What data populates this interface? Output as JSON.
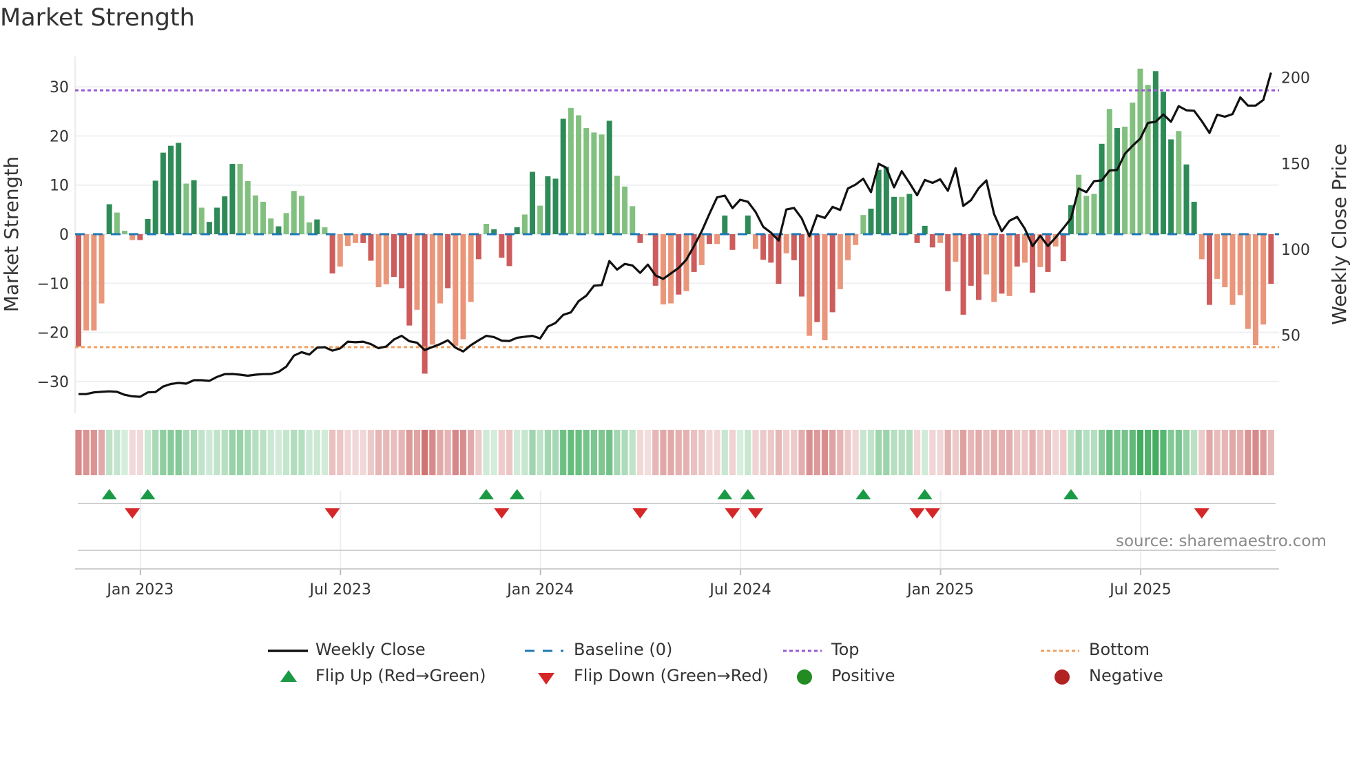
{
  "title": "Market Strength",
  "source": "source: sharemaestro.com",
  "chart_data": {
    "type": "bar+line",
    "title": "Market Strength",
    "ylabel_left": "Market Strength",
    "ylabel_right": "Weekly Close Price",
    "ylim_left": [
      -36,
      36
    ],
    "yticks_left": [
      "30",
      "20",
      "10",
      "0",
      "−10",
      "−20",
      "−30"
    ],
    "ytick_values_left": [
      30,
      20,
      10,
      0,
      -10,
      -20,
      -30
    ],
    "yticks_right": [
      "200",
      "150",
      "100",
      "50"
    ],
    "ytick_values_right": [
      200,
      150,
      100,
      50
    ],
    "xticks": [
      "Jan 2023",
      "Jul 2023",
      "Jan 2024",
      "Jul 2024",
      "Jan 2025",
      "Jul 2025"
    ],
    "xtick_week_index": [
      8,
      34,
      60,
      86,
      112,
      138
    ],
    "top_level": 29.3,
    "bottom_level": -23.0,
    "grid": true,
    "strength": [
      -22.9,
      -19.6,
      -19.6,
      -14.1,
      6.1,
      4.4,
      0.7,
      -1.2,
      -1.2,
      3.1,
      10.9,
      16.6,
      18.0,
      18.6,
      10.3,
      11.0,
      5.4,
      2.5,
      5.4,
      7.7,
      14.3,
      14.3,
      10.8,
      7.9,
      6.6,
      3.2,
      1.6,
      4.3,
      8.8,
      7.8,
      2.4,
      3.0,
      1.4,
      -8.0,
      -6.6,
      -2.4,
      -1.8,
      -1.8,
      -5.4,
      -10.8,
      -10.2,
      -8.7,
      -11.0,
      -18.6,
      -15.4,
      -28.4,
      -22.5,
      -14.1,
      -11.0,
      -22.7,
      -21.4,
      -13.8,
      -5.1,
      2.1,
      1.0,
      -4.8,
      -6.5,
      1.4,
      4.0,
      12.7,
      5.8,
      11.8,
      11.3,
      23.5,
      25.7,
      24.2,
      21.6,
      20.7,
      20.3,
      23.1,
      11.9,
      9.7,
      5.7,
      -1.8,
      -0.2,
      -10.5,
      -14.3,
      -14.1,
      -12.3,
      -11.6,
      -7.7,
      -6.3,
      -2.0,
      -2.0,
      3.8,
      -3.2,
      0.1,
      3.8,
      -3.0,
      -5.2,
      -5.8,
      -10.1,
      -3.9,
      -5.3,
      -12.7,
      -20.7,
      -17.9,
      -21.6,
      -15.9,
      -11.2,
      -5.3,
      -2.2,
      3.9,
      5.2,
      13.1,
      13.7,
      7.6,
      7.6,
      8.2,
      -1.8,
      1.7,
      -2.7,
      -1.8,
      -11.6,
      -5.6,
      -16.4,
      -10.5,
      -13.4,
      -8.2,
      -13.8,
      -12.1,
      -12.6,
      -6.6,
      -5.8,
      -11.9,
      -6.7,
      -7.7,
      -2.5,
      -5.5,
      5.9,
      12.1,
      7.8,
      8.2,
      18.4,
      25.5,
      21.6,
      21.9,
      26.8,
      33.7,
      30.4,
      33.2,
      29.0,
      19.3,
      21.0,
      14.2,
      6.6,
      -5.1,
      -14.4,
      -9.1,
      -10.8,
      -14.4,
      -12.4,
      -19.3,
      -22.6,
      -18.4,
      -10.1
    ],
    "shade": "dllldlllddddddldlddddllllldlllldldlllddlldddldlldllldlddddldldddllllldllldldlldldldlddldldddlddldldllllddddlddddldldddlldldldldlddllldldlllldddlddldllllllldldddlddldll",
    "weekly_close": [
      15.7,
      15.7,
      16.7,
      17.0,
      17.3,
      17.0,
      15.3,
      14.4,
      14.1,
      16.7,
      16.9,
      20.1,
      21.6,
      22.2,
      21.8,
      23.8,
      23.8,
      23.4,
      25.7,
      27.3,
      27.4,
      27.0,
      26.4,
      27.0,
      27.3,
      27.4,
      28.6,
      31.7,
      38.1,
      40.1,
      38.7,
      42.7,
      43.0,
      41.0,
      42.3,
      46.2,
      45.9,
      46.2,
      44.8,
      42.4,
      43.4,
      47.5,
      49.6,
      46.5,
      45.6,
      41.3,
      43.1,
      44.8,
      47.0,
      42.7,
      40.5,
      44.2,
      47.0,
      49.6,
      48.9,
      46.8,
      46.6,
      48.5,
      49.1,
      49.6,
      48.1,
      55.0,
      57.1,
      61.8,
      63.3,
      69.8,
      73.0,
      78.8,
      79.2,
      93.2,
      88.2,
      91.5,
      90.6,
      86.3,
      91.1,
      84.8,
      82.8,
      86.0,
      89.2,
      93.9,
      101.9,
      110.5,
      120.6,
      130.3,
      131.3,
      124.0,
      128.9,
      127.7,
      121.8,
      113.1,
      109.7,
      105.1,
      123.2,
      124.1,
      118.0,
      107.6,
      119.8,
      118.3,
      124.7,
      122.9,
      135.4,
      137.7,
      141.1,
      133.3,
      149.8,
      147.5,
      136.1,
      145.5,
      138.7,
      131.5,
      140.4,
      138.7,
      140.8,
      134.1,
      147.3,
      125.3,
      128.6,
      135.6,
      140.1,
      120.6,
      110.5,
      116.6,
      118.9,
      112.0,
      101.9,
      107.9,
      101.9,
      106.9,
      112.3,
      118.0,
      135.4,
      133.3,
      139.7,
      140.1,
      145.9,
      146.3,
      155.6,
      160.3,
      164.5,
      173.6,
      174.3,
      178.6,
      174.3,
      183.4,
      181.0,
      180.7,
      174.7,
      167.8,
      178.4,
      177.2,
      178.8,
      188.5,
      183.7,
      183.7,
      187.0,
      202.9
    ],
    "flip_up_weeks": [
      4,
      9,
      53,
      57,
      84,
      87,
      102,
      110,
      129
    ],
    "flip_down_weeks": [
      7,
      33,
      55,
      73,
      85,
      88,
      109,
      111,
      146
    ],
    "legend": {
      "weekly_close": "Weekly Close",
      "baseline": "Baseline (0)",
      "top": "Top",
      "bottom": "Bottom",
      "flip_up": "Flip Up (Red→Green)",
      "flip_down": "Flip Down (Green→Red)",
      "positive": "Positive",
      "negative": "Negative"
    },
    "colors": {
      "pos_dark": "#2e8b57",
      "pos_light": "#82c07f",
      "neg_dark": "#cd5c5c",
      "neg_light": "#e9967a",
      "line": "#111111",
      "baseline": "#1f77b4",
      "top": "#9b59d6",
      "bottom": "#f0a060",
      "flip_up": "#1a9a45",
      "flip_down": "#d62728",
      "positive": "#228b22",
      "negative": "#b22222"
    }
  }
}
